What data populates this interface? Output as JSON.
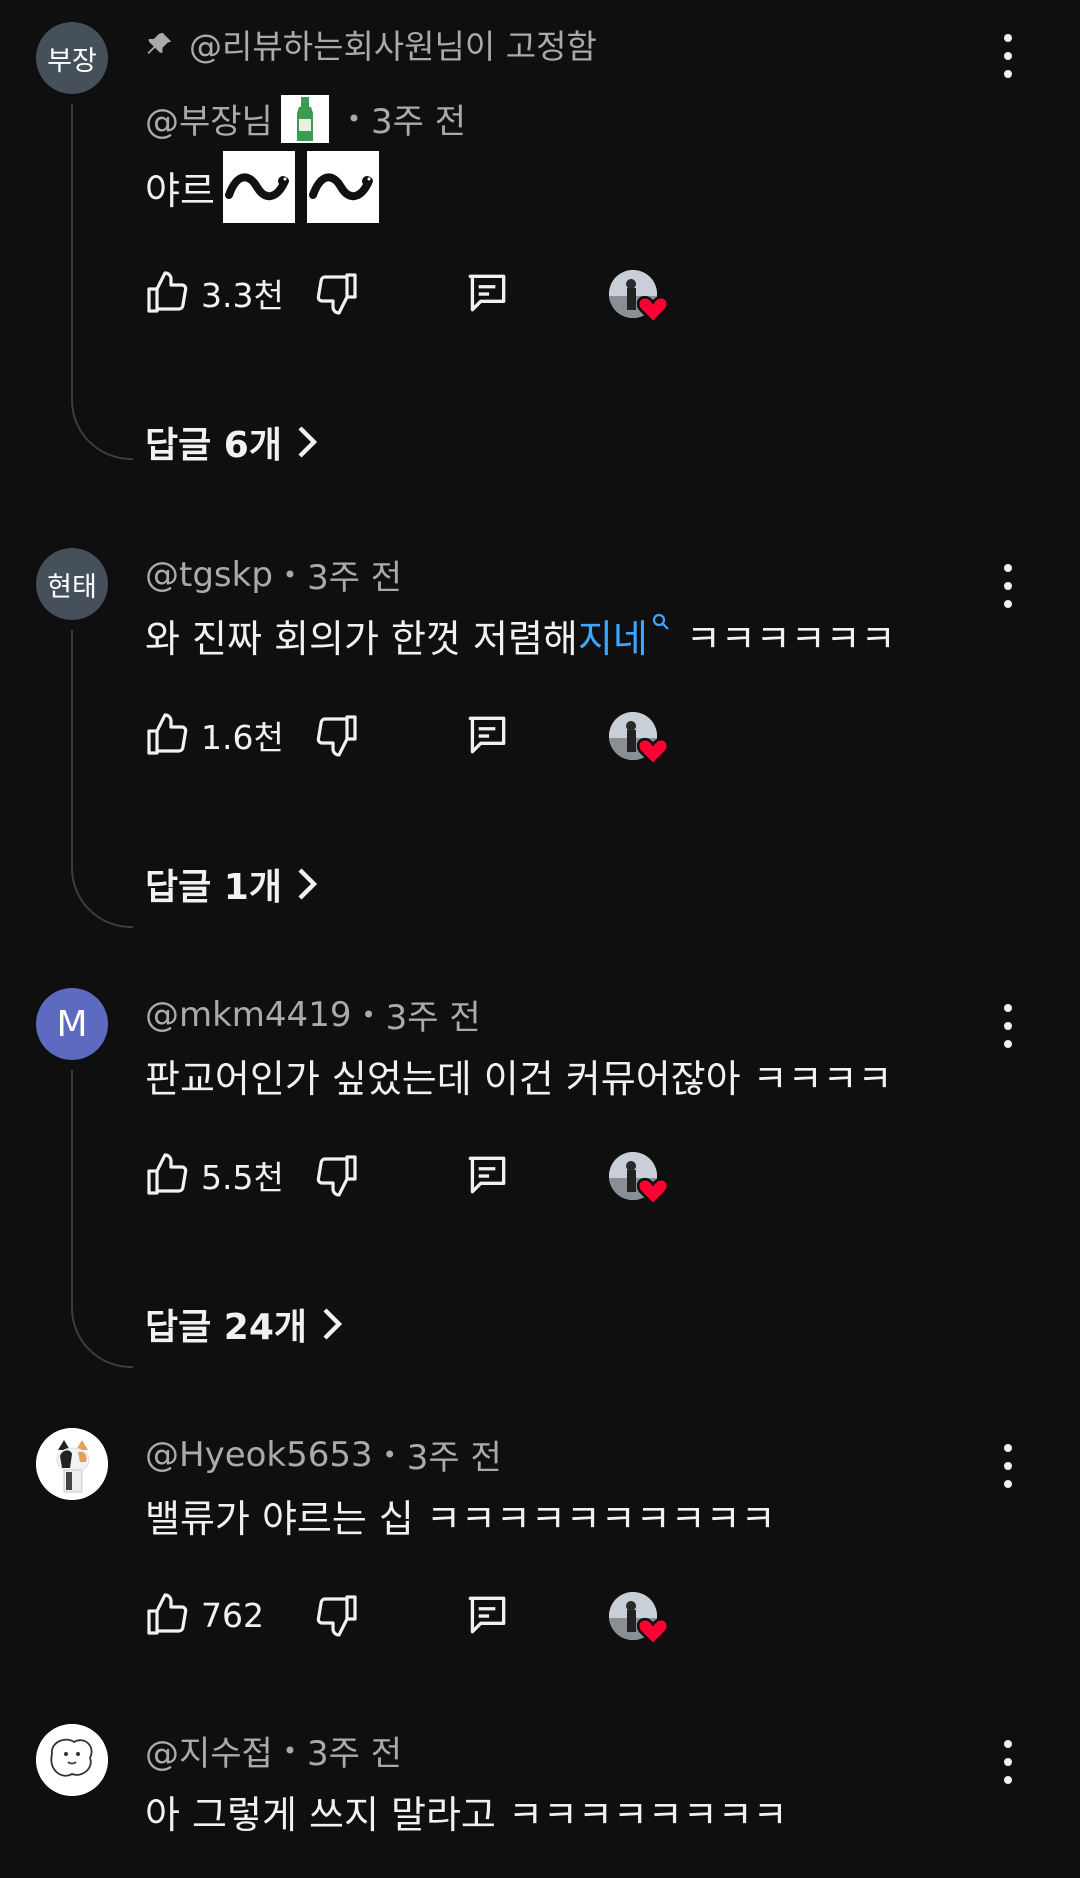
{
  "comments": [
    {
      "id": "c1",
      "avatar_text": "부장",
      "pinned_label": "@리뷰하는회사원님이 고정함",
      "author": "@부장님",
      "time": "3주 전",
      "text": "야르",
      "likes": "3.3천",
      "replies_label": "답글 6개"
    },
    {
      "id": "c2",
      "avatar_text": "현태",
      "author": "@tgskp",
      "time": "3주 전",
      "text_before_link": "와 진짜 회의가 한껏 저렴해",
      "link_text": "지네",
      "text_after_link": "ㅋㅋㅋㅋㅋㅋ",
      "likes": "1.6천",
      "replies_label": "답글 1개"
    },
    {
      "id": "c3",
      "avatar_text": "M",
      "author": "@mkm4419",
      "time": "3주 전",
      "text": "판교어인가 싶었는데 이건 커뮤어잖아 ㅋㅋㅋㅋ",
      "likes": "5.5천",
      "replies_label": "답글 24개"
    },
    {
      "id": "c4",
      "author": "@Hyeok5653",
      "time": "3주 전",
      "text": "밸류가 야르는 십 ㅋㅋㅋㅋㅋㅋㅋㅋㅋㅋ",
      "likes": "762"
    },
    {
      "id": "c5",
      "author": "@지수접",
      "time": "3주 전",
      "text": "아 그렇게 쓰지 말라고 ㅋㅋㅋㅋㅋㅋㅋㅋ"
    }
  ],
  "separator": "•",
  "icons": {
    "like": "thumbs-up-icon",
    "dislike": "thumbs-down-icon",
    "reply": "comment-icon",
    "more": "more-vert-icon",
    "pin": "pin-icon",
    "creator_heart": "heart-icon",
    "chevron": "chevron-right-icon"
  },
  "colors": {
    "background": "#0f0f0f",
    "text": "#f1f1f1",
    "secondary": "#aaaaaa",
    "link": "#3ea6ff",
    "heart": "#ff0033"
  }
}
